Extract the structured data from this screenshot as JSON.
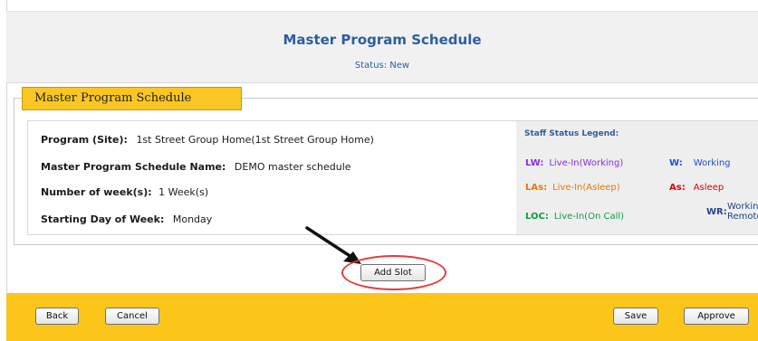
{
  "header": {
    "title": "Master Program Schedule",
    "status": "Status: New"
  },
  "section": {
    "legend_label": "Master Program Schedule"
  },
  "details": {
    "program_label": "Program (Site):",
    "program_value": "1st Street Group Home(1st Street Group Home)",
    "schedule_name_label": "Master Program Schedule Name:",
    "schedule_name_value": "DEMO master schedule",
    "weeks_label": "Number of week(s):",
    "weeks_value": "1 Week(s)",
    "start_day_label": "Starting Day of Week:",
    "start_day_value": "Monday"
  },
  "legend": {
    "title": "Staff Status Legend:",
    "items": [
      {
        "key": "LW:",
        "value": "Live-In(Working)",
        "color": "#8a2be2"
      },
      {
        "key": "W:",
        "value": "Working",
        "color": "#1f4fd0"
      },
      {
        "key": "LAs:",
        "value": "Live-In(Asleep)",
        "color": "#e07b00"
      },
      {
        "key": "As:",
        "value": "Asleep",
        "color": "#e00000"
      },
      {
        "key": "LOC:",
        "value": "Live-In(On Call)",
        "color": "#119944"
      },
      {
        "key": "WR:",
        "value_line1": "Working",
        "value_line2": "Remotely",
        "color": "#23458a"
      }
    ]
  },
  "actions": {
    "add_slot": "Add Slot"
  },
  "footer": {
    "back": "Back",
    "cancel": "Cancel",
    "save": "Save",
    "approve": "Approve"
  },
  "colors": {
    "accent_yellow": "#fbc51a",
    "title_blue": "#2c5f9e",
    "highlight_red": "#e23b3b"
  }
}
